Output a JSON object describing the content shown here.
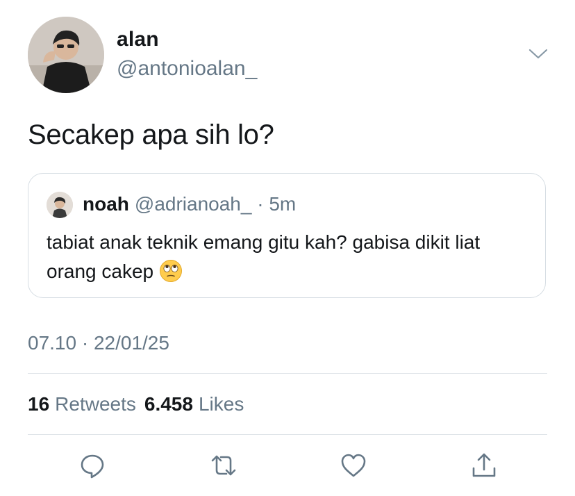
{
  "author": {
    "display_name": "alan",
    "handle": "@antonioalan_"
  },
  "tweet": {
    "text": "Secakep apa sih lo?",
    "timestamp": "07.10 · 22/01/25"
  },
  "quoted_tweet": {
    "display_name": "noah",
    "handle_and_time": "@adrianoah_ · 5m",
    "text": "tabiat anak teknik emang gitu kah? gabisa dikit liat orang cakep",
    "emoji": "face-with-rolling-eyes"
  },
  "stats": {
    "retweets_count": "16",
    "retweets_label": "Retweets",
    "likes_count": "6.458",
    "likes_label": "Likes"
  },
  "actions": [
    "reply-icon",
    "retweet-icon",
    "like-icon",
    "share-icon"
  ],
  "colors": {
    "secondary_text": "#657786",
    "primary_text": "#14171a",
    "border": "#d6dde3"
  }
}
